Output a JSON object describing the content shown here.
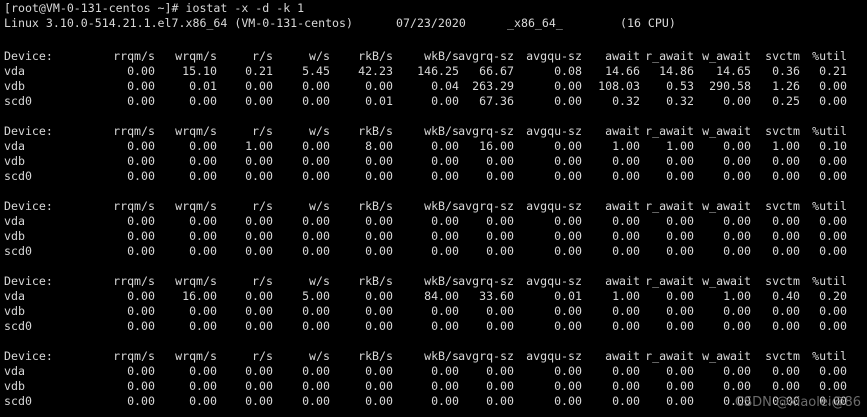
{
  "prompt": "[root@VM-0-131-centos ~]# ",
  "command": "iostat -x -d -k 1",
  "sysinfo": {
    "kernel": "Linux 3.10.0-514.21.1.el7.x86_64 (VM-0-131-centos)",
    "date": "07/23/2020",
    "arch": "_x86_64_",
    "cpus": "(16 CPU)"
  },
  "columns": [
    "Device:",
    "rrqm/s",
    "wrqm/s",
    "r/s",
    "w/s",
    "rkB/s",
    "wkB/s",
    "avgrq-sz",
    "avgqu-sz",
    "await",
    "r_await",
    "w_await",
    "svctm",
    "%util"
  ],
  "reports": [
    {
      "rows": [
        [
          "vda",
          "0.00",
          "15.10",
          "0.21",
          "5.45",
          "42.23",
          "146.25",
          "66.67",
          "0.08",
          "14.66",
          "14.86",
          "14.65",
          "0.36",
          "0.21"
        ],
        [
          "vdb",
          "0.00",
          "0.01",
          "0.00",
          "0.00",
          "0.00",
          "0.04",
          "263.29",
          "0.00",
          "108.03",
          "0.53",
          "290.58",
          "1.26",
          "0.00"
        ],
        [
          "scd0",
          "0.00",
          "0.00",
          "0.00",
          "0.00",
          "0.01",
          "0.00",
          "67.36",
          "0.00",
          "0.32",
          "0.32",
          "0.00",
          "0.25",
          "0.00"
        ]
      ]
    },
    {
      "rows": [
        [
          "vda",
          "0.00",
          "0.00",
          "1.00",
          "0.00",
          "8.00",
          "0.00",
          "16.00",
          "0.00",
          "1.00",
          "1.00",
          "0.00",
          "1.00",
          "0.10"
        ],
        [
          "vdb",
          "0.00",
          "0.00",
          "0.00",
          "0.00",
          "0.00",
          "0.00",
          "0.00",
          "0.00",
          "0.00",
          "0.00",
          "0.00",
          "0.00",
          "0.00"
        ],
        [
          "scd0",
          "0.00",
          "0.00",
          "0.00",
          "0.00",
          "0.00",
          "0.00",
          "0.00",
          "0.00",
          "0.00",
          "0.00",
          "0.00",
          "0.00",
          "0.00"
        ]
      ]
    },
    {
      "rows": [
        [
          "vda",
          "0.00",
          "0.00",
          "0.00",
          "0.00",
          "0.00",
          "0.00",
          "0.00",
          "0.00",
          "0.00",
          "0.00",
          "0.00",
          "0.00",
          "0.00"
        ],
        [
          "vdb",
          "0.00",
          "0.00",
          "0.00",
          "0.00",
          "0.00",
          "0.00",
          "0.00",
          "0.00",
          "0.00",
          "0.00",
          "0.00",
          "0.00",
          "0.00"
        ],
        [
          "scd0",
          "0.00",
          "0.00",
          "0.00",
          "0.00",
          "0.00",
          "0.00",
          "0.00",
          "0.00",
          "0.00",
          "0.00",
          "0.00",
          "0.00",
          "0.00"
        ]
      ]
    },
    {
      "rows": [
        [
          "vda",
          "0.00",
          "16.00",
          "0.00",
          "5.00",
          "0.00",
          "84.00",
          "33.60",
          "0.01",
          "1.00",
          "0.00",
          "1.00",
          "0.40",
          "0.20"
        ],
        [
          "vdb",
          "0.00",
          "0.00",
          "0.00",
          "0.00",
          "0.00",
          "0.00",
          "0.00",
          "0.00",
          "0.00",
          "0.00",
          "0.00",
          "0.00",
          "0.00"
        ],
        [
          "scd0",
          "0.00",
          "0.00",
          "0.00",
          "0.00",
          "0.00",
          "0.00",
          "0.00",
          "0.00",
          "0.00",
          "0.00",
          "0.00",
          "0.00",
          "0.00"
        ]
      ]
    },
    {
      "rows": [
        [
          "vda",
          "0.00",
          "0.00",
          "0.00",
          "0.00",
          "0.00",
          "0.00",
          "0.00",
          "0.00",
          "0.00",
          "0.00",
          "0.00",
          "0.00",
          "0.00"
        ],
        [
          "vdb",
          "0.00",
          "0.00",
          "0.00",
          "0.00",
          "0.00",
          "0.00",
          "0.00",
          "0.00",
          "0.00",
          "0.00",
          "0.00",
          "0.00",
          "0.00"
        ],
        [
          "scd0",
          "0.00",
          "0.00",
          "0.00",
          "0.00",
          "0.00",
          "0.00",
          "0.00",
          "0.00",
          "0.00",
          "0.00",
          "0.00",
          "0.00",
          "0.00"
        ]
      ]
    }
  ],
  "watermark": "CSDN @xiaolei@86",
  "colors": {
    "background": "#000000",
    "text": "#d8d8d8",
    "watermark": "#6c6c6c"
  }
}
